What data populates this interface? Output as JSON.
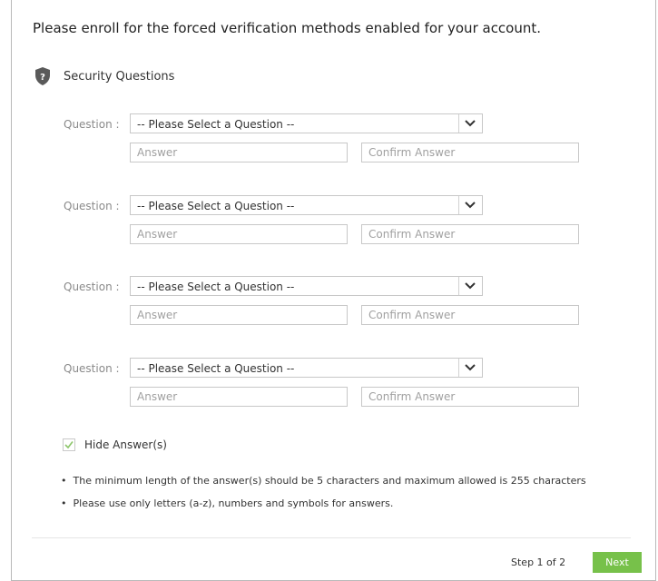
{
  "heading": "Please enroll for the forced verification methods enabled for your account.",
  "section": {
    "title": "Security Questions",
    "icon": "shield-question-icon"
  },
  "questions": [
    {
      "label": "Question :",
      "selected": "-- Please Select a Question --",
      "answer_placeholder": "Answer",
      "confirm_placeholder": "Confirm Answer"
    },
    {
      "label": "Question :",
      "selected": "-- Please Select a Question --",
      "answer_placeholder": "Answer",
      "confirm_placeholder": "Confirm Answer"
    },
    {
      "label": "Question :",
      "selected": "-- Please Select a Question --",
      "answer_placeholder": "Answer",
      "confirm_placeholder": "Confirm Answer"
    },
    {
      "label": "Question :",
      "selected": "-- Please Select a Question --",
      "answer_placeholder": "Answer",
      "confirm_placeholder": "Confirm Answer"
    }
  ],
  "hide_answers": {
    "label": "Hide Answer(s)",
    "checked": true
  },
  "rules": [
    "The minimum length of the answer(s) should be 5 characters and maximum allowed is 255 characters",
    "Please use only letters (a-z), numbers and symbols for answers."
  ],
  "footer": {
    "step": "Step 1 of 2",
    "next_label": "Next"
  },
  "colors": {
    "accent": "#77c14a",
    "check": "#8cc56a",
    "icon": "#5a5a5a"
  }
}
